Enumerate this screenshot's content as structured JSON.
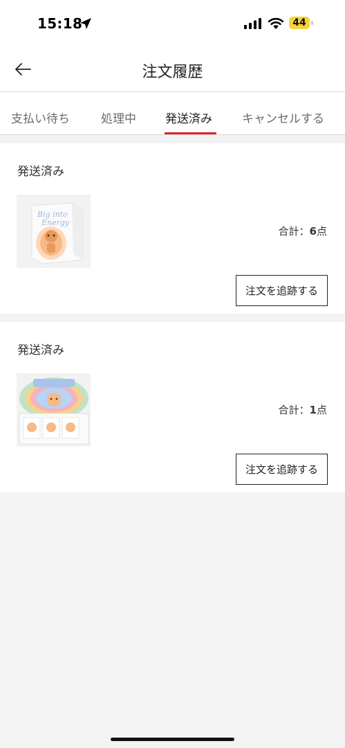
{
  "status_bar": {
    "time": "15:18",
    "battery": "44",
    "icons": [
      "location-arrow-icon",
      "signal-bars-icon",
      "wifi-icon",
      "battery-icon"
    ],
    "battery_color": "#f4d43b"
  },
  "header": {
    "title": "注文履歴",
    "back_icon": "arrow-left-icon"
  },
  "tabs": [
    {
      "label": "支払い待ち",
      "active": false
    },
    {
      "label": "処理中",
      "active": false
    },
    {
      "label": "発送済み",
      "active": true
    },
    {
      "label": "キャンセルする",
      "active": false
    }
  ],
  "accent_color": "#d9232d",
  "orders": [
    {
      "status": "発送済み",
      "total_label": "合計：",
      "quantity": "6",
      "unit": "点",
      "track_label": "注文を追跡する"
    },
    {
      "status": "発送済み",
      "total_label": "合計：",
      "quantity": "1",
      "unit": "点",
      "track_label": "注文を追跡する"
    }
  ]
}
